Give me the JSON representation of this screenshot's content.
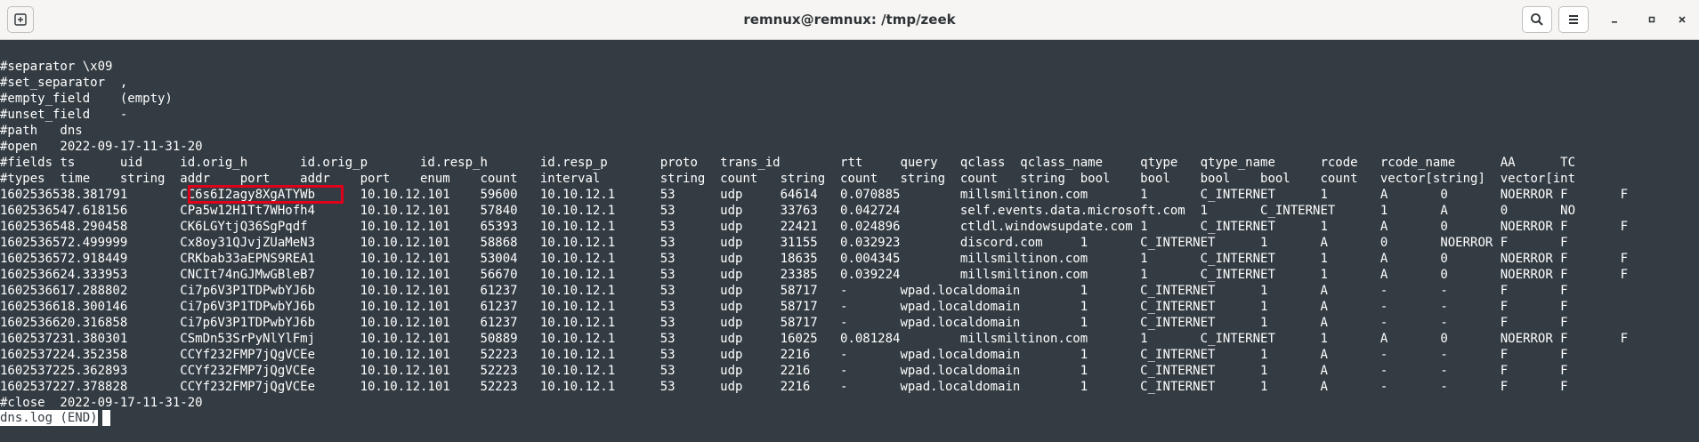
{
  "window": {
    "title": "remnux@remnux: /tmp/zeek"
  },
  "icons": {
    "new_tab": "new-tab-icon",
    "search": "search-icon",
    "menu": "hamburger-menu-icon",
    "minimize": "minimize-icon",
    "maximize": "maximize-icon",
    "close": "close-icon"
  },
  "colors": {
    "terminal_bg": "#333c43",
    "terminal_fg": "#ffffff",
    "highlight_border": "#e0001b",
    "titlebar_bg": "#f6f5f4"
  },
  "terminal": {
    "lines": [
      "#separator \\x09",
      "#set_separator  ,",
      "#empty_field    (empty)",
      "#unset_field    -",
      "#path   dns",
      "#open   2022-09-17-11-31-20",
      "#fields ts      uid     id.orig_h       id.orig_p       id.resp_h       id.resp_p       proto   trans_id        rtt     query   qclass  qclass_name     qtype   qtype_name      rcode   rcode_name      AA      TC",
      "#types  time    string  addr    port    addr    port    enum    count   interval        string  count   string  count   string  count   string  bool    bool    bool    bool    count   vector[string]  vector[int",
      "1602536538.381791       CC6s6I2agy8XgATYWb      10.10.12.101    59600   10.10.12.1      53      udp     64614   0.070885        millsmiltinon.com       1       C_INTERNET      1       A       0       NOERROR F       F",
      "1602536547.618156       CPa5w12H1Tt7WHofh4      10.10.12.101    57840   10.10.12.1      53      udp     33763   0.042724        self.events.data.microsoft.com  1       C_INTERNET      1       A       0       NO",
      "1602536548.290458       CK6LGYtjQ36SgPqdf       10.10.12.101    65393   10.10.12.1      53      udp     22421   0.024896        ctldl.windowsupdate.com 1       C_INTERNET      1       A       0       NOERROR F       F",
      "1602536572.499999       Cx8oy31QJvjZUaMeN3      10.10.12.101    58868   10.10.12.1      53      udp     31155   0.032923        discord.com     1       C_INTERNET      1       A       0       NOERROR F       F",
      "1602536572.918449       CRKbab33aEPNS9REA1      10.10.12.101    53004   10.10.12.1      53      udp     18635   0.004345        millsmiltinon.com       1       C_INTERNET      1       A       0       NOERROR F       F",
      "1602536624.333953       CNCIt74nGJMwGBleB7      10.10.12.101    56670   10.10.12.1      53      udp     23385   0.039224        millsmiltinon.com       1       C_INTERNET      1       A       0       NOERROR F       F",
      "1602536617.288802       Ci7p6V3P1TDPwbYJ6b      10.10.12.101    61237   10.10.12.1      53      udp     58717   -       wpad.localdomain        1       C_INTERNET      1       A       -       -       F       F",
      "1602536618.300146       Ci7p6V3P1TDPwbYJ6b      10.10.12.101    61237   10.10.12.1      53      udp     58717   -       wpad.localdomain        1       C_INTERNET      1       A       -       -       F       F",
      "1602536620.316858       Ci7p6V3P1TDPwbYJ6b      10.10.12.101    61237   10.10.12.1      53      udp     58717   -       wpad.localdomain        1       C_INTERNET      1       A       -       -       F       F",
      "1602537231.380301       CSmDn53SrPyNlYlFmj      10.10.12.101    50889   10.10.12.1      53      udp     16025   0.081284        millsmiltinon.com       1       C_INTERNET      1       A       0       NOERROR F       F",
      "1602537224.352358       CCYf232FMP7jQgVCEe      10.10.12.101    52223   10.10.12.1      53      udp     2216    -       wpad.localdomain        1       C_INTERNET      1       A       -       -       F       F",
      "1602537225.362893       CCYf232FMP7jQgVCEe      10.10.12.101    52223   10.10.12.1      53      udp     2216    -       wpad.localdomain        1       C_INTERNET      1       A       -       -       F       F",
      "1602537227.378828       CCYf232FMP7jQgVCEe      10.10.12.101    52223   10.10.12.1      53      udp     2216    -       wpad.localdomain        1       C_INTERNET      1       A       -       -       F       F",
      "#close  2022-09-17-11-31-20"
    ],
    "status_line": "dns.log (END)",
    "highlighted_uid": "CC6s6I2agy8XgATYWb"
  }
}
